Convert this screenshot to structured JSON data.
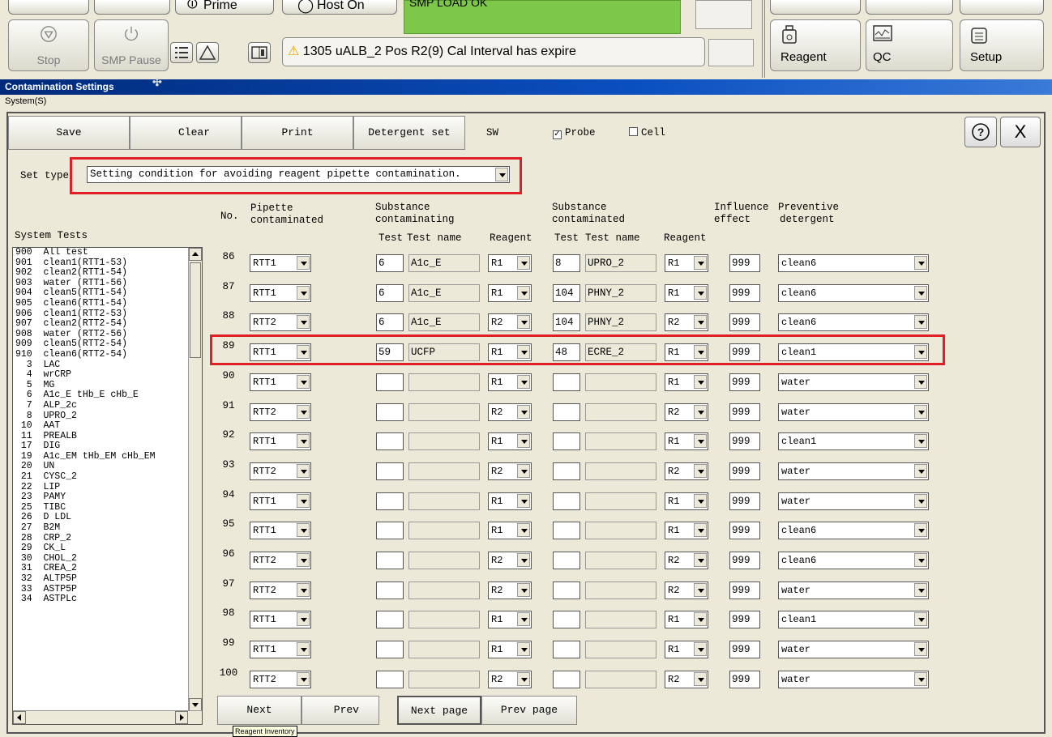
{
  "toolbar_top": {
    "prime_label": "Prime",
    "host_label": "Host On",
    "status_text": "SMP LOAD OK",
    "stop_label": "Stop",
    "smp_pause_label": "SMP Pause",
    "alarm_text": "1305  uALB_2 Pos R2(9) Cal Interval has expire",
    "reagent_label": "Reagent",
    "qc_label": "QC",
    "setup_label": "Setup"
  },
  "window": {
    "title": "Contamination Settings",
    "breadcrumb": "System(S)"
  },
  "actions": {
    "save": "Save",
    "clear": "Clear",
    "print": "Print",
    "detergent_set": "Detergent set",
    "sw": "SW",
    "probe": "Probe",
    "probe_checked": true,
    "cell": "Cell",
    "cell_checked": false,
    "help_icon": "help-icon",
    "close_label": "X"
  },
  "set_type": {
    "label": "Set type",
    "value": "Setting condition for avoiding reagent pipette contamination."
  },
  "headers": {
    "system_tests": "System Tests",
    "no": "No.",
    "pipette_1": "Pipette",
    "pipette_2": "contaminated",
    "substance_1": "Substance",
    "substance_2": "contaminating",
    "substance_b1": "Substance",
    "substance_b2": "contaminated",
    "test": "Test",
    "test_name": "Test name",
    "reagent": "Reagent",
    "test_b": "Test",
    "test_name_b": "Test name",
    "reagent_b": "Reagent",
    "influence_1": "Influence",
    "influence_2": "effect",
    "preventive_1": "Preventive",
    "preventive_2": "detergent"
  },
  "system_tests": [
    "900  All test",
    "901  clean1(RTT1-53)",
    "902  clean2(RTT1-54)",
    "903  water (RTT1-56)",
    "904  clean5(RTT1-54)",
    "905  clean6(RTT1-54)",
    "906  clean1(RTT2-53)",
    "907  clean2(RTT2-54)",
    "908  water (RTT2-56)",
    "909  clean5(RTT2-54)",
    "910  clean6(RTT2-54)",
    "  3  LAC",
    "  4  wrCRP",
    "  5  MG",
    "  6  A1c_E tHb_E cHb_E",
    "  7  ALP_2c",
    "  8  UPRO_2",
    " 10  AAT",
    " 11  PREALB",
    " 17  DIG",
    " 19  A1c_EM tHb_EM cHb_EM",
    " 20  UN",
    " 21  CYSC_2",
    " 22  LIP",
    " 23  PAMY",
    " 25  TIBC",
    " 26  D LDL",
    " 27  B2M",
    " 28  CRP_2",
    " 29  CK_L",
    " 30  CHOL_2",
    " 31  CREA_2",
    " 32  ALTP5P",
    " 33  ASTP5P",
    " 34  ASTPLc"
  ],
  "rows": [
    {
      "no": "86",
      "pipette": "RTT1",
      "test": "6",
      "test_name": "A1c_E",
      "reagent": "R1",
      "test_b": "8",
      "test_name_b": "UPRO_2",
      "reagent_b": "R1",
      "influence": "999",
      "detergent": "clean6"
    },
    {
      "no": "87",
      "pipette": "RTT1",
      "test": "6",
      "test_name": "A1c_E",
      "reagent": "R1",
      "test_b": "104",
      "test_name_b": "PHNY_2",
      "reagent_b": "R1",
      "influence": "999",
      "detergent": "clean6"
    },
    {
      "no": "88",
      "pipette": "RTT2",
      "test": "6",
      "test_name": "A1c_E",
      "reagent": "R2",
      "test_b": "104",
      "test_name_b": "PHNY_2",
      "reagent_b": "R2",
      "influence": "999",
      "detergent": "clean6"
    },
    {
      "no": "89",
      "pipette": "RTT1",
      "test": "59",
      "test_name": "UCFP",
      "reagent": "R1",
      "test_b": "48",
      "test_name_b": "ECRE_2",
      "reagent_b": "R1",
      "influence": "999",
      "detergent": "clean1"
    },
    {
      "no": "90",
      "pipette": "RTT1",
      "test": "",
      "test_name": "",
      "reagent": "R1",
      "test_b": "",
      "test_name_b": "",
      "reagent_b": "R1",
      "influence": "999",
      "detergent": "water"
    },
    {
      "no": "91",
      "pipette": "RTT2",
      "test": "",
      "test_name": "",
      "reagent": "R2",
      "test_b": "",
      "test_name_b": "",
      "reagent_b": "R2",
      "influence": "999",
      "detergent": "water"
    },
    {
      "no": "92",
      "pipette": "RTT1",
      "test": "",
      "test_name": "",
      "reagent": "R1",
      "test_b": "",
      "test_name_b": "",
      "reagent_b": "R1",
      "influence": "999",
      "detergent": "clean1"
    },
    {
      "no": "93",
      "pipette": "RTT2",
      "test": "",
      "test_name": "",
      "reagent": "R2",
      "test_b": "",
      "test_name_b": "",
      "reagent_b": "R2",
      "influence": "999",
      "detergent": "water"
    },
    {
      "no": "94",
      "pipette": "RTT1",
      "test": "",
      "test_name": "",
      "reagent": "R1",
      "test_b": "",
      "test_name_b": "",
      "reagent_b": "R1",
      "influence": "999",
      "detergent": "water"
    },
    {
      "no": "95",
      "pipette": "RTT1",
      "test": "",
      "test_name": "",
      "reagent": "R1",
      "test_b": "",
      "test_name_b": "",
      "reagent_b": "R1",
      "influence": "999",
      "detergent": "clean6"
    },
    {
      "no": "96",
      "pipette": "RTT2",
      "test": "",
      "test_name": "",
      "reagent": "R2",
      "test_b": "",
      "test_name_b": "",
      "reagent_b": "R2",
      "influence": "999",
      "detergent": "clean6"
    },
    {
      "no": "97",
      "pipette": "RTT2",
      "test": "",
      "test_name": "",
      "reagent": "R2",
      "test_b": "",
      "test_name_b": "",
      "reagent_b": "R2",
      "influence": "999",
      "detergent": "water"
    },
    {
      "no": "98",
      "pipette": "RTT1",
      "test": "",
      "test_name": "",
      "reagent": "R1",
      "test_b": "",
      "test_name_b": "",
      "reagent_b": "R1",
      "influence": "999",
      "detergent": "clean1"
    },
    {
      "no": "99",
      "pipette": "RTT1",
      "test": "",
      "test_name": "",
      "reagent": "R1",
      "test_b": "",
      "test_name_b": "",
      "reagent_b": "R1",
      "influence": "999",
      "detergent": "water"
    },
    {
      "no": "100",
      "pipette": "RTT2",
      "test": "",
      "test_name": "",
      "reagent": "R2",
      "test_b": "",
      "test_name_b": "",
      "reagent_b": "R2",
      "influence": "999",
      "detergent": "water"
    }
  ],
  "paging": {
    "next": "Next",
    "prev": "Prev",
    "next_page": "Next page",
    "prev_page": "Prev page"
  },
  "tooltip": "Reagent Inventory",
  "colors": {
    "highlight_red": "#e01e25",
    "status_green": "#7dc84a",
    "title_blue": "#0a4fc0"
  }
}
